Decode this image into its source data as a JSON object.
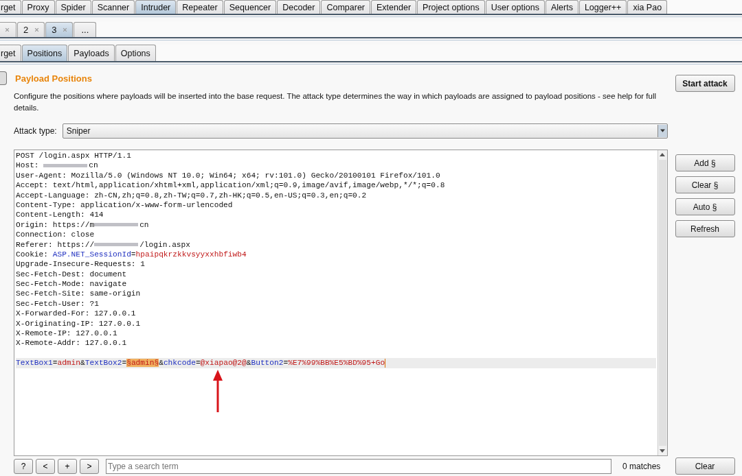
{
  "main_tabs": [
    {
      "label": "rget",
      "selected": false
    },
    {
      "label": "Proxy",
      "selected": false
    },
    {
      "label": "Spider",
      "selected": false
    },
    {
      "label": "Scanner",
      "selected": false
    },
    {
      "label": "Intruder",
      "selected": true
    },
    {
      "label": "Repeater",
      "selected": false
    },
    {
      "label": "Sequencer",
      "selected": false
    },
    {
      "label": "Decoder",
      "selected": false
    },
    {
      "label": "Comparer",
      "selected": false
    },
    {
      "label": "Extender",
      "selected": false
    },
    {
      "label": "Project options",
      "selected": false
    },
    {
      "label": "User options",
      "selected": false
    },
    {
      "label": "Alerts",
      "selected": false
    },
    {
      "label": "Logger++",
      "selected": false
    },
    {
      "label": "xia Pao",
      "selected": false
    }
  ],
  "attack_tabs": [
    {
      "kind": "close_only",
      "selected": false
    },
    {
      "kind": "numbered",
      "label": "2",
      "selected": false
    },
    {
      "kind": "numbered",
      "label": "3",
      "selected": true
    },
    {
      "kind": "more",
      "label": "..."
    }
  ],
  "sub_tabs": [
    {
      "label": "rget",
      "selected": false
    },
    {
      "label": "Positions",
      "selected": true
    },
    {
      "label": "Payloads",
      "selected": false
    },
    {
      "label": "Options",
      "selected": false
    }
  ],
  "section": {
    "title": "Payload Positions",
    "description": "Configure the positions where payloads will be inserted into the base request. The attack type determines the way in which payloads are assigned to payload positions - see help for full details.",
    "start_button": "Start attack"
  },
  "attack_type": {
    "label": "Attack type:",
    "value": "Sniper"
  },
  "request_lines": [
    {
      "highlighted": false,
      "segments": [
        {
          "kind": "plain",
          "text": "POST /login.aspx HTTP/1.1"
        }
      ]
    },
    {
      "highlighted": false,
      "segments": [
        {
          "kind": "plain",
          "text": "Host: "
        },
        {
          "kind": "redacted"
        },
        {
          "kind": "plain",
          "text": "cn"
        }
      ]
    },
    {
      "highlighted": false,
      "segments": [
        {
          "kind": "plain",
          "text": "User-Agent: Mozilla/5.0 (Windows NT 10.0; Win64; x64; rv:101.0) Gecko/20100101 Firefox/101.0"
        }
      ]
    },
    {
      "highlighted": false,
      "segments": [
        {
          "kind": "plain",
          "text": "Accept: text/html,application/xhtml+xml,application/xml;q=0.9,image/avif,image/webp,*/*;q=0.8"
        }
      ]
    },
    {
      "highlighted": false,
      "segments": [
        {
          "kind": "plain",
          "text": "Accept-Language: zh-CN,zh;q=0.8,zh-TW;q=0.7,zh-HK;q=0.5,en-US;q=0.3,en;q=0.2"
        }
      ]
    },
    {
      "highlighted": false,
      "segments": [
        {
          "kind": "plain",
          "text": "Content-Type: application/x-www-form-urlencoded"
        }
      ]
    },
    {
      "highlighted": false,
      "segments": [
        {
          "kind": "plain",
          "text": "Content-Length: 414"
        }
      ]
    },
    {
      "highlighted": false,
      "segments": [
        {
          "kind": "plain",
          "text": "Origin: https://m"
        },
        {
          "kind": "redacted"
        },
        {
          "kind": "plain",
          "text": "cn"
        }
      ]
    },
    {
      "highlighted": false,
      "segments": [
        {
          "kind": "plain",
          "text": "Connection: close"
        }
      ]
    },
    {
      "highlighted": false,
      "segments": [
        {
          "kind": "plain",
          "text": "Referer: https://"
        },
        {
          "kind": "redacted"
        },
        {
          "kind": "plain",
          "text": "/login.aspx"
        }
      ]
    },
    {
      "highlighted": false,
      "segments": [
        {
          "kind": "plain",
          "text": "Cookie: "
        },
        {
          "kind": "name",
          "text": "ASP.NET_SessionId"
        },
        {
          "kind": "plain",
          "text": "="
        },
        {
          "kind": "value",
          "text": "hpaipqkrzkkvsyyxxhbfiwb4"
        }
      ]
    },
    {
      "highlighted": false,
      "segments": [
        {
          "kind": "plain",
          "text": "Upgrade-Insecure-Requests: 1"
        }
      ]
    },
    {
      "highlighted": false,
      "segments": [
        {
          "kind": "plain",
          "text": "Sec-Fetch-Dest: document"
        }
      ]
    },
    {
      "highlighted": false,
      "segments": [
        {
          "kind": "plain",
          "text": "Sec-Fetch-Mode: navigate"
        }
      ]
    },
    {
      "highlighted": false,
      "segments": [
        {
          "kind": "plain",
          "text": "Sec-Fetch-Site: same-origin"
        }
      ]
    },
    {
      "highlighted": false,
      "segments": [
        {
          "kind": "plain",
          "text": "Sec-Fetch-User: ?1"
        }
      ]
    },
    {
      "highlighted": false,
      "segments": [
        {
          "kind": "plain",
          "text": "X-Forwarded-For: 127.0.0.1"
        }
      ]
    },
    {
      "highlighted": false,
      "segments": [
        {
          "kind": "plain",
          "text": "X-Originating-IP: 127.0.0.1"
        }
      ]
    },
    {
      "highlighted": false,
      "segments": [
        {
          "kind": "plain",
          "text": "X-Remote-IP: 127.0.0.1"
        }
      ]
    },
    {
      "highlighted": false,
      "segments": [
        {
          "kind": "plain",
          "text": "X-Remote-Addr: 127.0.0.1"
        }
      ]
    },
    {
      "highlighted": false
    },
    {
      "highlighted": true,
      "segments": [
        {
          "kind": "name",
          "text": "TextBox1"
        },
        {
          "kind": "plain",
          "text": "="
        },
        {
          "kind": "value",
          "text": "admin"
        },
        {
          "kind": "plain",
          "text": "&"
        },
        {
          "kind": "name",
          "text": "TextBox2"
        },
        {
          "kind": "plain",
          "text": "="
        },
        {
          "kind": "marker",
          "text": "§admin§"
        },
        {
          "kind": "plain",
          "text": "&"
        },
        {
          "kind": "name",
          "text": "chkcode"
        },
        {
          "kind": "plain",
          "text": "="
        },
        {
          "kind": "value",
          "text": "@xiapao@2@"
        },
        {
          "kind": "plain",
          "text": "&"
        },
        {
          "kind": "name",
          "text": "Button2"
        },
        {
          "kind": "plain",
          "text": "="
        },
        {
          "kind": "value",
          "text": "%E7%99%BB%E5%BD%95+Go"
        }
      ]
    }
  ],
  "side_buttons": [
    "Add §",
    "Clear §",
    "Auto §",
    "Refresh"
  ],
  "search_bar": {
    "buttons": [
      "?",
      "<",
      "+",
      ">"
    ],
    "placeholder": "Type a search term",
    "matches": "0 matches",
    "clear_button": "Clear"
  }
}
